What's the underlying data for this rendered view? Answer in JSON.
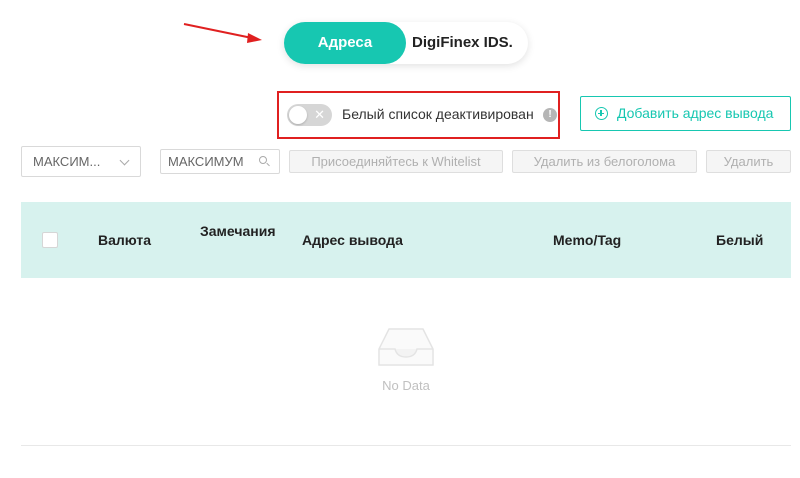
{
  "tabs": {
    "active": "Адреса",
    "other": "DigiFinex IDS."
  },
  "whitelist": {
    "label": "Белый список деактивирован",
    "info_icon": "info-icon",
    "toggle_on": false
  },
  "actions": {
    "add_address": "Добавить адрес вывода"
  },
  "filters": {
    "select_value": "МАКСИМ...",
    "search_value": "МАКСИМУМ",
    "join_whitelist": "Присоединяйтесь к Whitelist",
    "remove_whitelist": "Удалить из белоголома",
    "delete": "Удалить"
  },
  "table": {
    "columns": [
      "Валюта",
      "Замечания",
      "Адрес вывода",
      "Memo/Tag",
      "Белый"
    ],
    "rows": []
  },
  "empty": {
    "text": "No Data"
  },
  "colors": {
    "accent": "#17c7b1",
    "header_bg": "#d7f2ee",
    "highlight": "#e02020"
  }
}
